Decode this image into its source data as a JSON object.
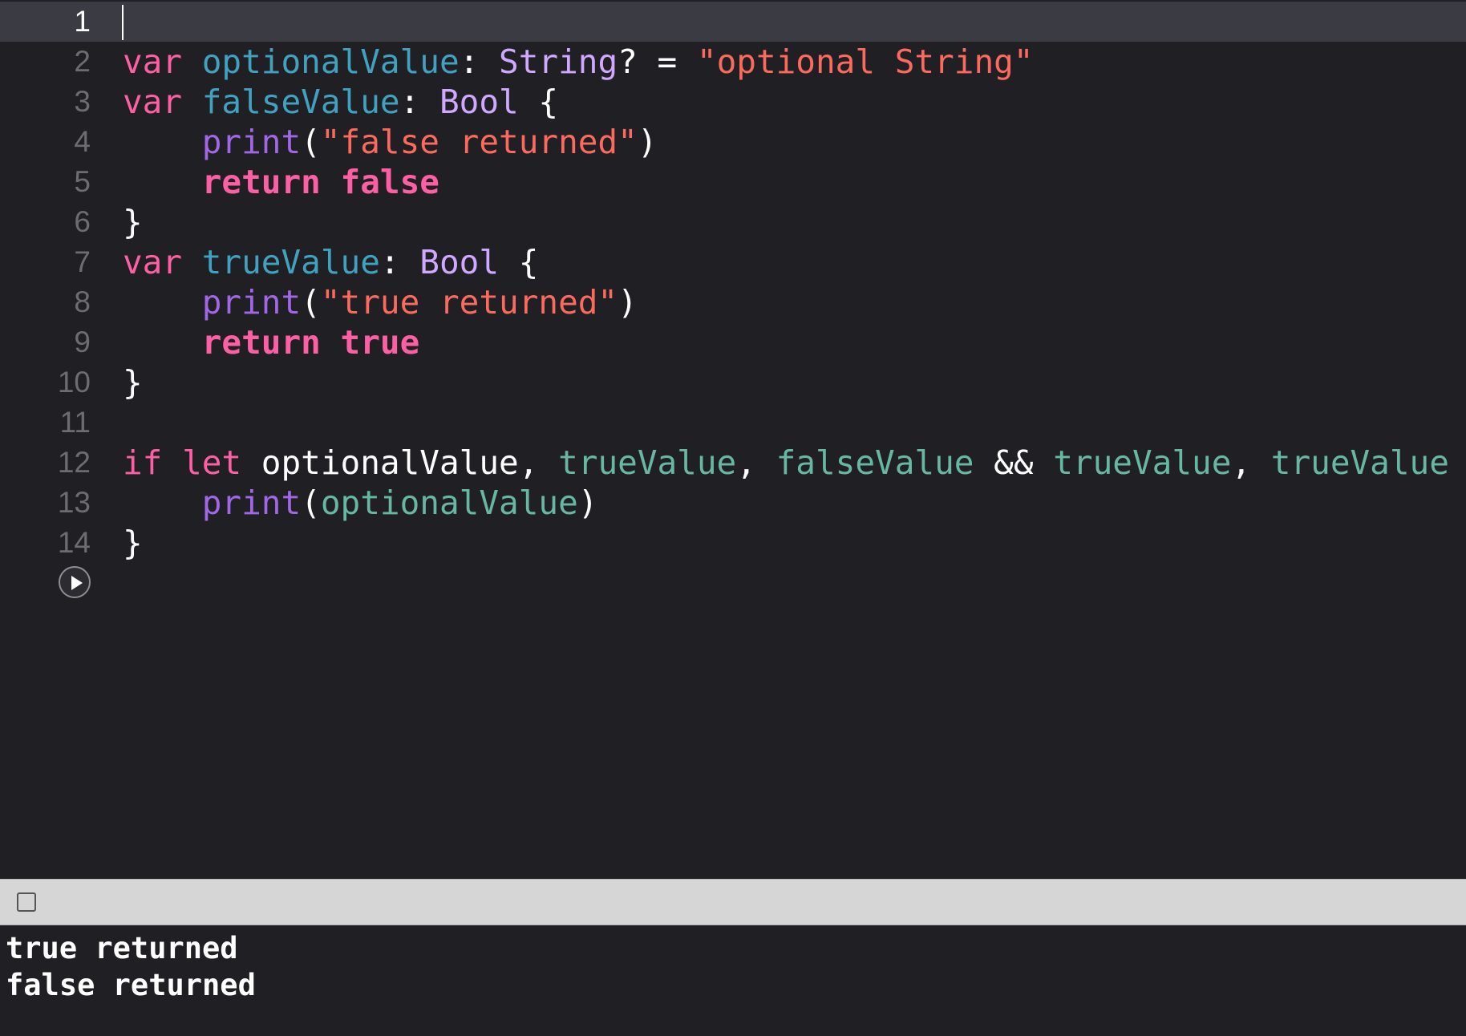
{
  "editor": {
    "lines": [
      {
        "num": "1"
      },
      {
        "num": "2",
        "tokens": [
          "var",
          " ",
          "optionalValue",
          ": ",
          "String",
          "? = ",
          "\"optional String\""
        ]
      },
      {
        "num": "3",
        "tokens": [
          "var",
          " ",
          "falseValue",
          ": ",
          "Bool",
          " {"
        ]
      },
      {
        "num": "4",
        "tokens": [
          "    ",
          "print",
          "(",
          "\"false returned\"",
          ")"
        ]
      },
      {
        "num": "5",
        "tokens": [
          "    ",
          "return",
          " ",
          "false"
        ]
      },
      {
        "num": "6",
        "tokens": [
          "}"
        ]
      },
      {
        "num": "7",
        "tokens": [
          "var",
          " ",
          "trueValue",
          ": ",
          "Bool",
          " {"
        ]
      },
      {
        "num": "8",
        "tokens": [
          "    ",
          "print",
          "(",
          "\"true returned\"",
          ")"
        ]
      },
      {
        "num": "9",
        "tokens": [
          "    ",
          "return",
          " ",
          "true"
        ]
      },
      {
        "num": "10",
        "tokens": [
          "}"
        ]
      },
      {
        "num": "11"
      },
      {
        "num": "12",
        "tokens": [
          "if",
          " ",
          "let",
          " optionalValue, ",
          "trueValue",
          ", ",
          "falseValue",
          " && ",
          "trueValue",
          ", ",
          "trueValue",
          "  {"
        ]
      },
      {
        "num": "13",
        "tokens": [
          "    ",
          "print",
          "(",
          "optionalValue",
          ")"
        ]
      },
      {
        "num": "14",
        "tokens": [
          "}"
        ]
      }
    ]
  },
  "run_button": {
    "icon": "play-icon"
  },
  "debug_bar": {
    "toggle_icon": "checkbox-icon"
  },
  "console": {
    "lines": [
      "true returned",
      "false returned"
    ]
  },
  "colors": {
    "keyword": "#fc5fa3",
    "variable": "#41a1c0",
    "type": "#d0a8ff",
    "string": "#fc6a5d",
    "function": "#a167e6",
    "reference": "#67b7a4",
    "background": "#1f1f24",
    "current_line": "#3b3b43"
  }
}
